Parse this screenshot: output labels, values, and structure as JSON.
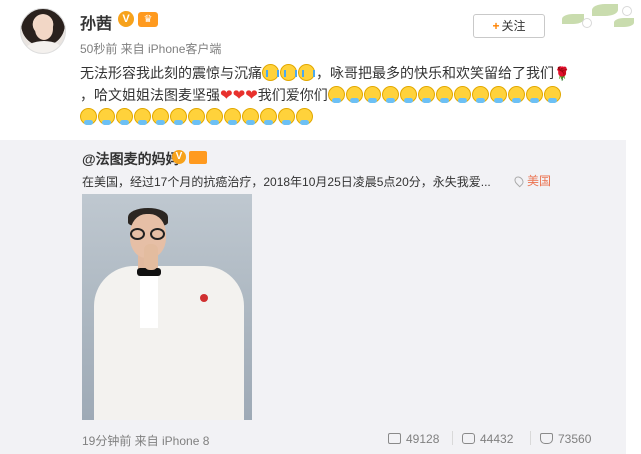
{
  "post": {
    "username": "孙茜",
    "meta": "50秒前 来自 iPhone客户端",
    "follow_label": "关注",
    "text_line1": "无法形容我此刻的震惊与沉痛",
    "text_line1b": "，咏哥把最多的快乐和欢笑留给了我们",
    "text_line2a": "，哈文姐姐法图麦坚强",
    "text_line2b": "我们爱你们"
  },
  "repost": {
    "username": "@法图麦的妈妈",
    "text": "在美国，经过17个月的抗癌治疗，2018年10月25日凌晨5点20分，永失我爱",
    "ellipsis": "...",
    "location": "美国",
    "time_source": "19分钟前 来自 iPhone 8",
    "reposts": "49128",
    "comments": "44432",
    "likes": "73560"
  },
  "icons": {
    "verified": "V",
    "vip": "vip-crown-icon",
    "rose": "🌹",
    "heart": "❤"
  },
  "colors": {
    "accent": "#ff8200",
    "location": "#eb7350",
    "repost_bg": "#f2f2f5"
  }
}
